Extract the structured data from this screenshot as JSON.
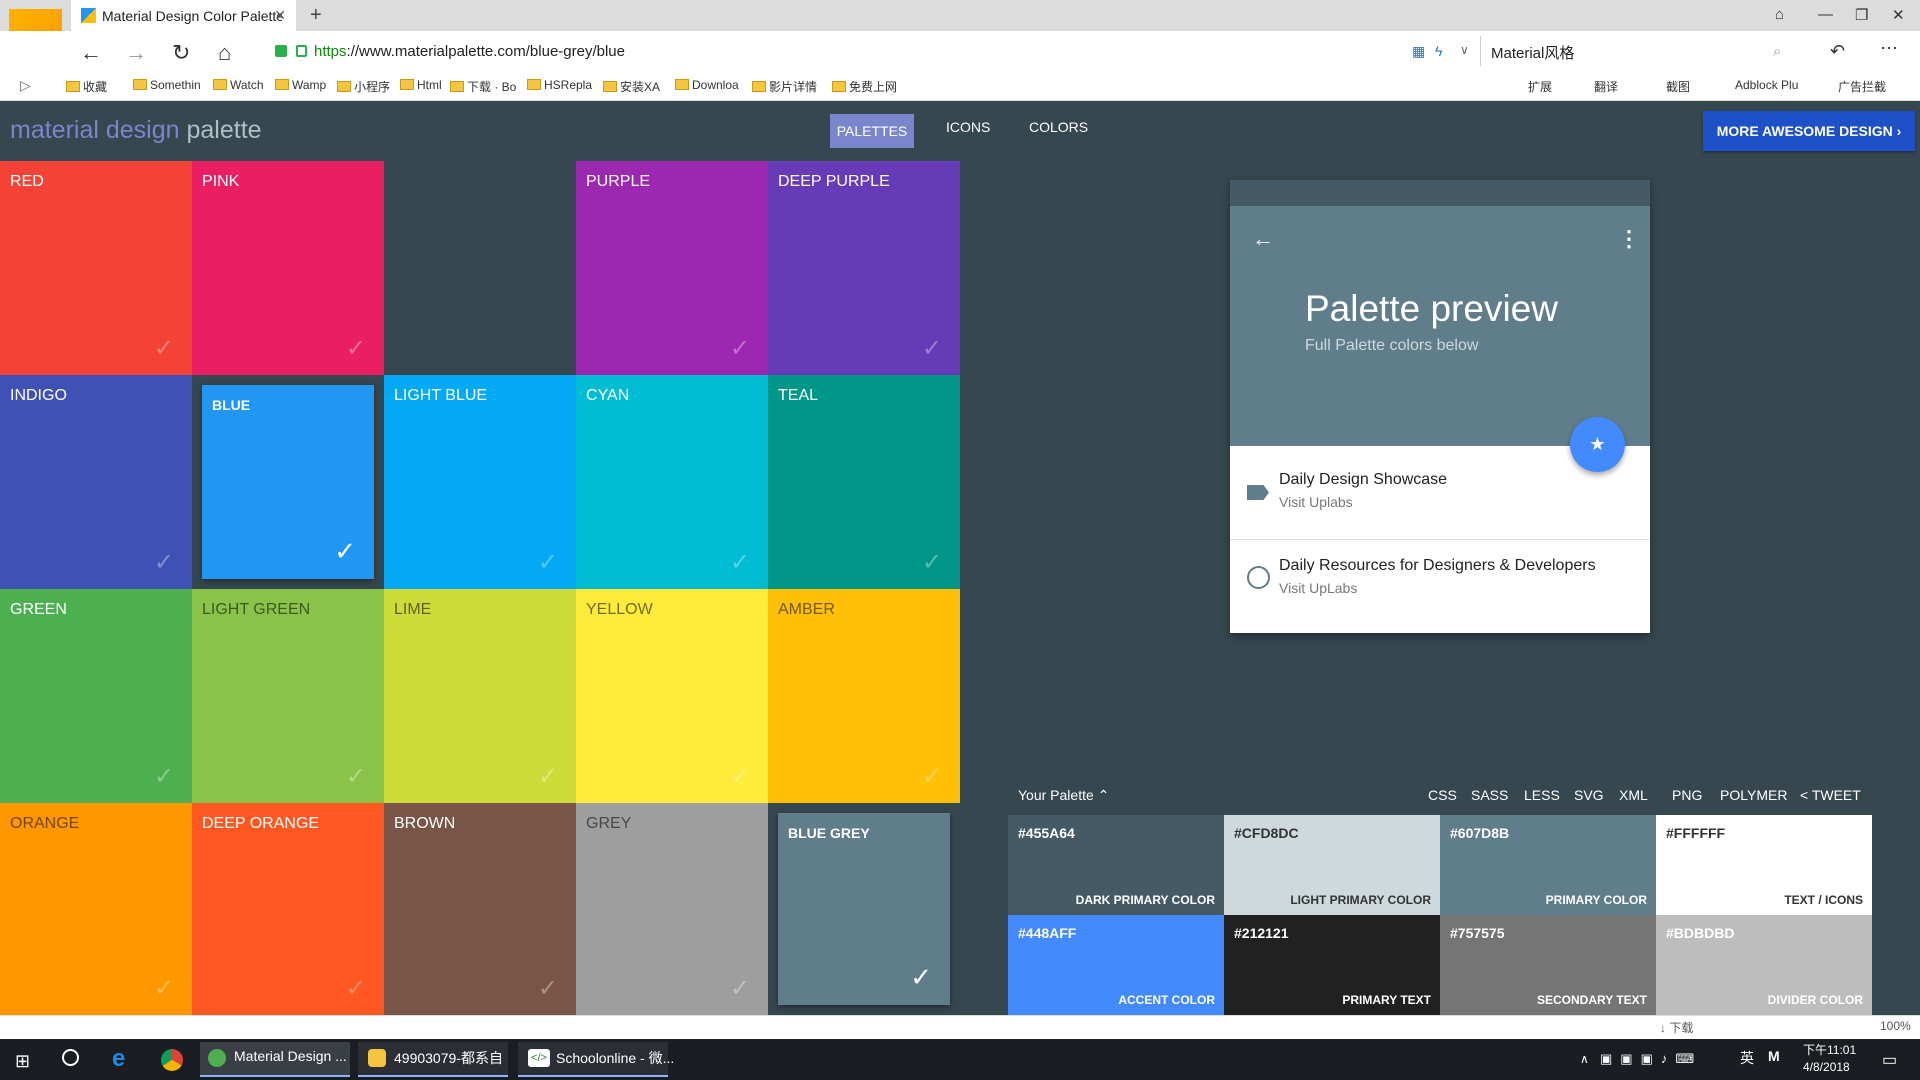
{
  "browser": {
    "tab_title": "Material Design Color Palette",
    "url_scheme": "https",
    "url_rest": "://www.materialpalette.com/blue-grey/blue",
    "search_text": "Material风格",
    "zoom": "100%",
    "download_label": "下载"
  },
  "bookmarks": [
    "收藏",
    "Somethin",
    "Watch",
    "Wamp",
    "小程序",
    "Html",
    "下载 · Bo",
    "HSRepla",
    "安装XA",
    "Downloa",
    "影片详情",
    "免费上网"
  ],
  "extensions": [
    "扩展",
    "翻译",
    "截图",
    "Adblock Plu",
    "广告拦截"
  ],
  "app": {
    "brand_a": "material design",
    "brand_b": "palette",
    "nav": {
      "palettes": "PALETTES",
      "icons": "ICONS",
      "colors": "COLORS"
    },
    "cta": "MORE AWESOME DESIGN"
  },
  "tiles": [
    {
      "name": "RED",
      "color": "#f44336"
    },
    {
      "name": "PINK",
      "color": "#e91e63"
    },
    {
      "name": "",
      "color": "#37474f"
    },
    {
      "name": "PURPLE",
      "color": "#9c27b0"
    },
    {
      "name": "DEEP PURPLE",
      "color": "#673ab7"
    },
    {
      "name": "INDIGO",
      "color": "#3f51b5"
    },
    {
      "name": "BLUE",
      "color": "#2196f3",
      "selected": true
    },
    {
      "name": "LIGHT BLUE",
      "color": "#03a9f4"
    },
    {
      "name": "CYAN",
      "color": "#00bcd4"
    },
    {
      "name": "TEAL",
      "color": "#009688"
    },
    {
      "name": "GREEN",
      "color": "#4caf50"
    },
    {
      "name": "LIGHT GREEN",
      "color": "#8bc34a"
    },
    {
      "name": "LIME",
      "color": "#cddc39"
    },
    {
      "name": "YELLOW",
      "color": "#ffeb3b"
    },
    {
      "name": "AMBER",
      "color": "#ffc107"
    },
    {
      "name": "ORANGE",
      "color": "#ff9800"
    },
    {
      "name": "DEEP ORANGE",
      "color": "#ff5722"
    },
    {
      "name": "BROWN",
      "color": "#795548"
    },
    {
      "name": "GREY",
      "color": "#9e9e9e"
    },
    {
      "name": "BLUE GREY",
      "color": "#607d8b",
      "selected": true
    }
  ],
  "preview": {
    "title": "Palette preview",
    "subtitle": "Full Palette colors below",
    "item1_title": "Daily Design Showcase",
    "item1_sub": "Visit Uplabs",
    "item2_title": "Daily Resources for Designers & Developers",
    "item2_sub": "Visit UpLabs"
  },
  "your_palette": {
    "title": "Your Palette",
    "exports": [
      "CSS",
      "SASS",
      "LESS",
      "SVG",
      "XML",
      "PNG",
      "POLYMER",
      "TWEET"
    ],
    "swatches": [
      {
        "hex": "#455A64",
        "name": "DARK PRIMARY COLOR",
        "bg": "#455a64",
        "fg": "#ffffff"
      },
      {
        "hex": "#CFD8DC",
        "name": "LIGHT PRIMARY COLOR",
        "bg": "#cfd8dc",
        "fg": "#333333"
      },
      {
        "hex": "#607D8B",
        "name": "PRIMARY COLOR",
        "bg": "#607d8b",
        "fg": "#ffffff"
      },
      {
        "hex": "#FFFFFF",
        "name": "TEXT / ICONS",
        "bg": "#ffffff",
        "fg": "#333333"
      },
      {
        "hex": "#448AFF",
        "name": "ACCENT COLOR",
        "bg": "#448aff",
        "fg": "#ffffff"
      },
      {
        "hex": "#212121",
        "name": "PRIMARY TEXT",
        "bg": "#212121",
        "fg": "#ffffff"
      },
      {
        "hex": "#757575",
        "name": "SECONDARY TEXT",
        "bg": "#757575",
        "fg": "#ffffff"
      },
      {
        "hex": "#BDBDBD",
        "name": "DIVIDER COLOR",
        "bg": "#bdbdbd",
        "fg": "#ffffff"
      }
    ]
  },
  "taskbar": {
    "apps": [
      "Material Design ...",
      "49903079-都系自",
      "Schoolonline - 微..."
    ],
    "ime": "英",
    "time": "下午11:01",
    "date": "4/8/2018"
  }
}
